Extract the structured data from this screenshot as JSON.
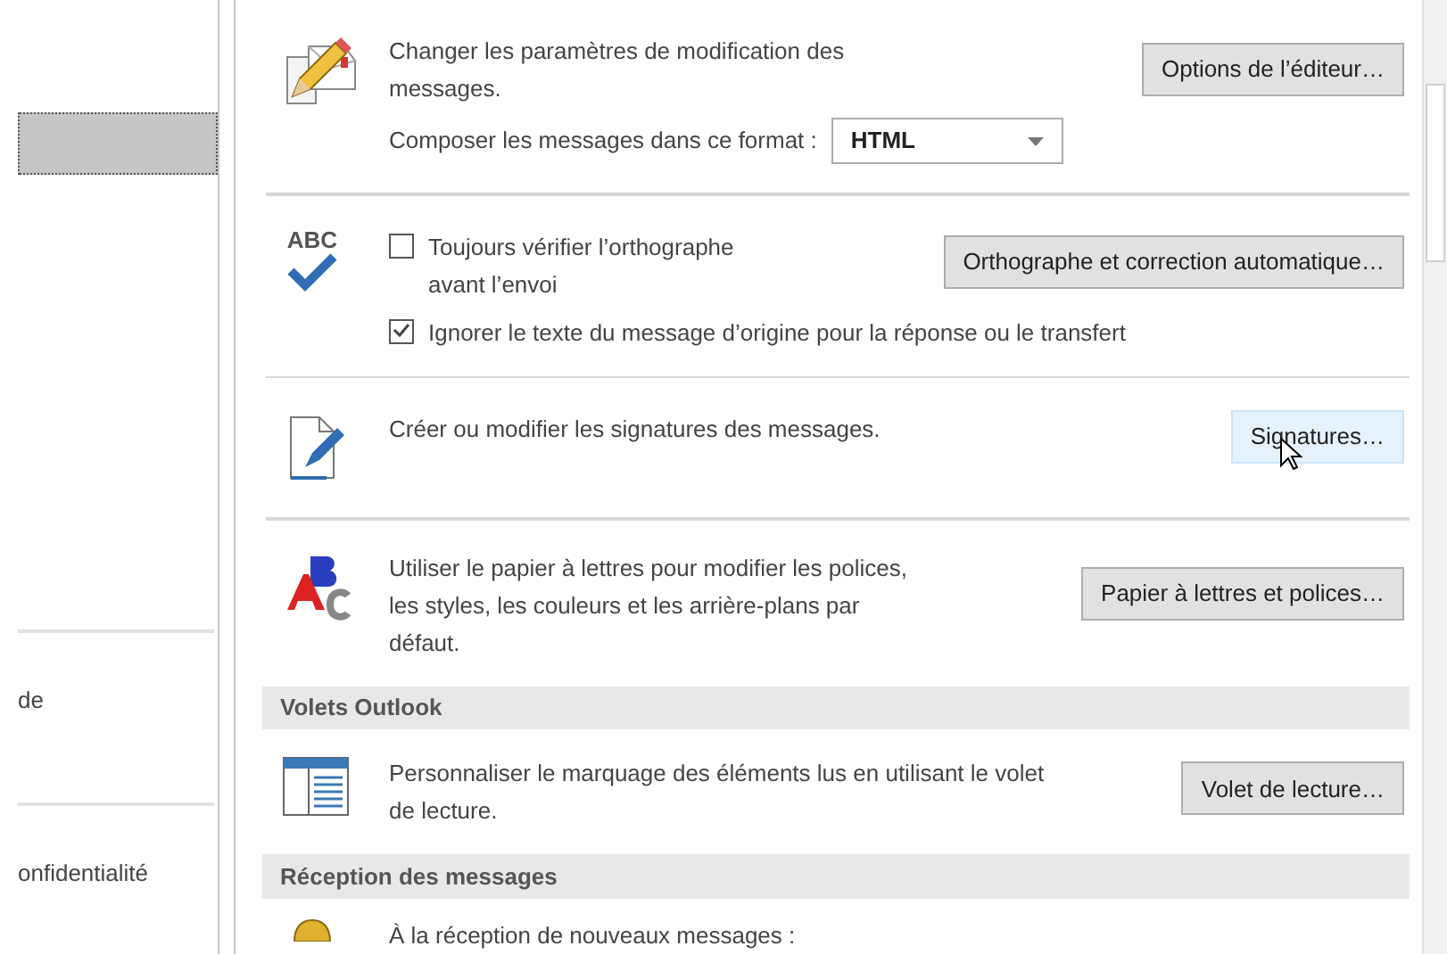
{
  "sidebar": {
    "items": [
      {
        "selected": true
      },
      {
        "label": "de",
        "selected": false
      },
      {
        "label": "onfidentialité",
        "selected": false
      }
    ]
  },
  "blocks": [
    {
      "kind": "option",
      "text": "Changer les paramètres de modification des messages.",
      "format_label": "Composer les messages dans ce format :",
      "format": {
        "value": "HTML"
      },
      "button": {
        "label": "Options de l’éditeur…",
        "hovered": false
      }
    },
    {
      "kind": "option",
      "icon_text": "ABC",
      "checkboxes": [
        {
          "label": "Toujours vérifier l’orthographe avant l’envoi",
          "checked": false
        },
        {
          "label": "Ignorer le texte du message d’origine pour la réponse ou le transfert",
          "checked": true
        }
      ],
      "button": {
        "label": "Orthographe et correction automatique…",
        "hovered": false
      }
    },
    {
      "kind": "option",
      "text": "Créer ou modifier les signatures des messages.",
      "button": {
        "label": "Signatures…",
        "hovered": true
      }
    },
    {
      "kind": "option",
      "text": "Utiliser le papier à lettres pour modifier les polices, les styles, les couleurs et les arrière-plans par défaut.",
      "button": {
        "label": "Papier à lettres et polices…",
        "hovered": false
      }
    },
    {
      "kind": "header",
      "title": "Volets Outlook"
    },
    {
      "kind": "option",
      "text": "Personnaliser le marquage des éléments lus en utilisant le volet de lecture.",
      "button": {
        "label": "Volet de lecture…",
        "hovered": false
      }
    },
    {
      "kind": "header",
      "title": "Réception des messages"
    },
    {
      "kind": "option",
      "text": "À la réception de nouveaux messages :"
    }
  ]
}
